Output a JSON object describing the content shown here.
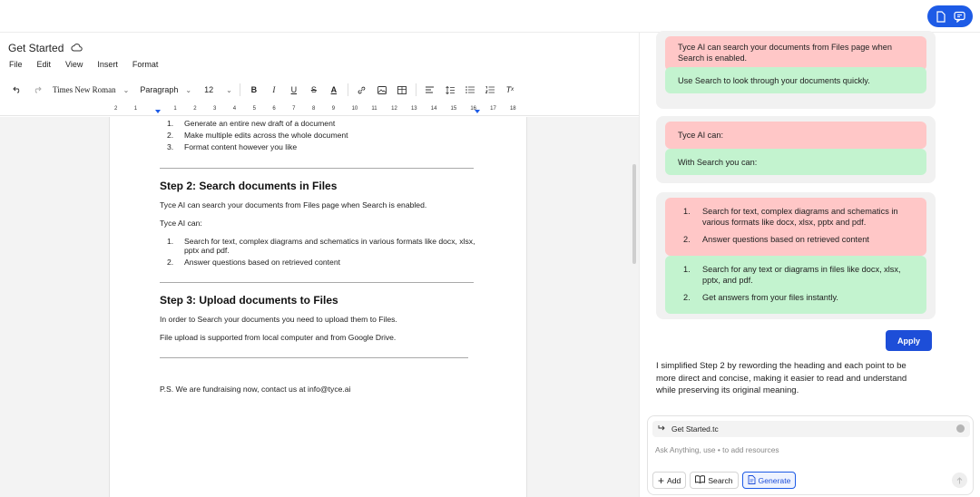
{
  "editor": {
    "doc_title": "Get Started",
    "menu": [
      "File",
      "Edit",
      "View",
      "Insert",
      "Format"
    ],
    "toolbar": {
      "font": "Times New Roman",
      "style": "Paragraph",
      "size": "12"
    },
    "ruler_numbers": [
      "2",
      "1",
      "",
      "1",
      "2",
      "3",
      "4",
      "5",
      "6",
      "7",
      "8",
      "9",
      "10",
      "11",
      "12",
      "13",
      "14",
      "15",
      "16",
      "17",
      "18"
    ],
    "content": {
      "list1": [
        {
          "num": "1.",
          "text": "Generate an entire new draft of a document"
        },
        {
          "num": "2.",
          "text": "Make multiple edits across the whole document"
        },
        {
          "num": "3.",
          "text": "Format content however you like"
        }
      ],
      "step2_heading": "Step 2: Search documents in Files",
      "step2_para1": "Tyce AI can search your documents from Files page when Search is enabled.",
      "step2_para2": "Tyce AI can:",
      "list2": [
        {
          "num": "1.",
          "text": "Search for text, complex diagrams and schematics in various formats like docx, xlsx, pptx and pdf."
        },
        {
          "num": "2.",
          "text": "Answer questions based on retrieved content"
        }
      ],
      "step3_heading": "Step 3: Upload documents to Files",
      "step3_para1": "In order to Search your documents you need to upload them to Files.",
      "step3_para2": "File upload is supported from local computer and from Google Drive.",
      "ps": "P.S. We are fundraising now, contact us at info@tyce.ai"
    }
  },
  "assistant": {
    "card1": {
      "old": "Tyce AI can search your documents from Files page when Search is enabled.",
      "new": "Use Search to look through your documents quickly."
    },
    "card2": {
      "old": "Tyce AI can:",
      "new": "With Search you can:"
    },
    "card3": {
      "old": [
        {
          "num": "1.",
          "text": "Search for text, complex diagrams and schematics in various formats like docx, xlsx, pptx and pdf."
        },
        {
          "num": "2.",
          "text": "Answer questions based on retrieved content"
        }
      ],
      "new": [
        {
          "num": "1.",
          "text": "Search for any text or diagrams in files like docx, xlsx, pptx, and pdf."
        },
        {
          "num": "2.",
          "text": "Get answers from your files instantly."
        }
      ]
    },
    "apply_label": "Apply",
    "summary": "I simplified Step 2 by rewording the heading and each point to be more direct and concise, making it easier to read and understand while preserving its original meaning.",
    "composer": {
      "attachment": "Get Started.tc",
      "placeholder": "Ask Anything, use • to add resources",
      "add_label": "Add",
      "search_label": "Search",
      "generate_label": "Generate"
    }
  },
  "colors": {
    "accent": "#1d5be6",
    "removed": "#ffc7c7",
    "added": "#c3f3cf"
  }
}
